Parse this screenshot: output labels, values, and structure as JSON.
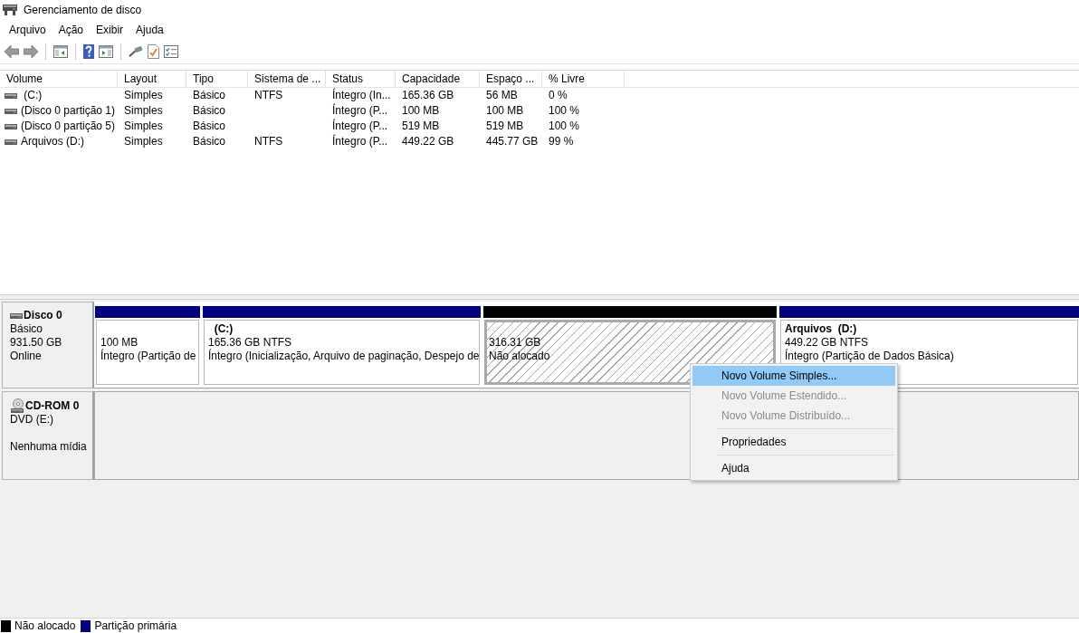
{
  "window": {
    "title": "Gerenciamento de disco"
  },
  "menu": [
    {
      "label": "Arquivo"
    },
    {
      "label": "Ação"
    },
    {
      "label": "Exibir"
    },
    {
      "label": "Ajuda"
    }
  ],
  "volume_table": {
    "columns": [
      "Volume",
      "Layout",
      "Tipo",
      "Sistema de ...",
      "Status",
      "Capacidade",
      "Espaço ...",
      "% Livre"
    ],
    "rows": [
      {
        "volume": " (C:)",
        "layout": "Simples",
        "tipo": "Básico",
        "sistema": "NTFS",
        "status": "Íntegro (In...",
        "capacidade": "165.36 GB",
        "espaco": "56 MB",
        "livre": "0 %"
      },
      {
        "volume": "(Disco 0 partição 1)",
        "layout": "Simples",
        "tipo": "Básico",
        "status": "Íntegro (P...",
        "capacidade": "100 MB",
        "espaco": "100 MB",
        "livre": "100 %"
      },
      {
        "volume": "(Disco 0 partição 5)",
        "layout": "Simples",
        "tipo": "Básico",
        "status": "Íntegro (P...",
        "capacidade": "519 MB",
        "espaco": "519 MB",
        "livre": "100 %"
      },
      {
        "volume": "Arquivos (D:)",
        "layout": "Simples",
        "tipo": "Básico",
        "sistema": "NTFS",
        "status": "Íntegro (P...",
        "capacidade": "449.22 GB",
        "espaco": "445.77 GB",
        "livre": "99 %"
      }
    ]
  },
  "disks": [
    {
      "kind": "disk",
      "name": "Disco 0",
      "type": "Básico",
      "size": "931.50 GB",
      "status": "Online",
      "partitions": [
        {
          "kind": "primary",
          "selected": false,
          "size": "100 MB",
          "status": "Íntegro (Partição de"
        },
        {
          "kind": "primary",
          "selected": false,
          "label": "  (C:)",
          "size": "165.36 GB NTFS",
          "status": "Íntegro (Inicialização, Arquivo de paginação, Despejo de"
        },
        {
          "kind": "unallocated",
          "selected": true,
          "size": "316.31 GB",
          "status": "Não alocado"
        },
        {
          "kind": "primary",
          "selected": false,
          "label": "Arquivos  (D:)",
          "size": "449.22 GB NTFS",
          "status": "Íntegro (Partição de Dados Básica)"
        }
      ]
    },
    {
      "kind": "cdrom",
      "name": "CD-ROM 0",
      "type": "DVD (E:)",
      "status": "Nenhuma mídia"
    }
  ],
  "context_menu": {
    "items": [
      {
        "kind": "item",
        "label": "Novo Volume Simples...",
        "selected": true,
        "disabled": false
      },
      {
        "kind": "item",
        "label": "Novo Volume Estendido...",
        "selected": false,
        "disabled": true
      },
      {
        "kind": "item",
        "label": "Novo Volume Distribuído...",
        "selected": false,
        "disabled": true
      },
      {
        "kind": "separator"
      },
      {
        "kind": "item",
        "label": "Propriedades",
        "selected": false,
        "disabled": false
      },
      {
        "kind": "separator"
      },
      {
        "kind": "item",
        "label": "Ajuda",
        "selected": false,
        "disabled": false
      }
    ]
  },
  "legend": [
    {
      "label": "Não alocado",
      "color": "#000000"
    },
    {
      "label": "Partição primária",
      "color": "#000080"
    }
  ]
}
